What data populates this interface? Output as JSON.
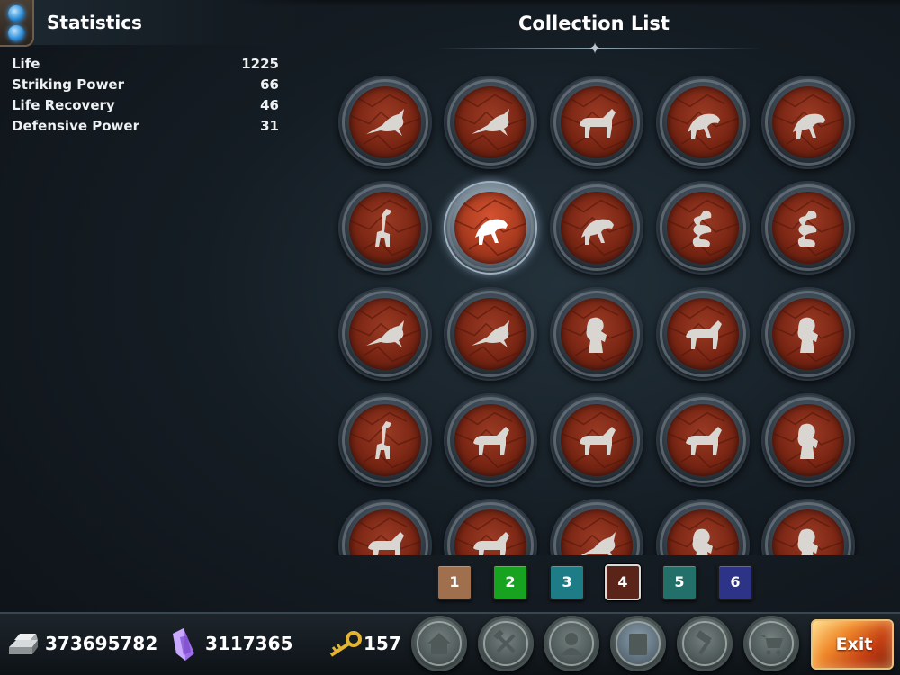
{
  "stats": {
    "title": "Statistics",
    "rows": [
      {
        "label": "Life",
        "value": "1225"
      },
      {
        "label": "Striking Power",
        "value": "66"
      },
      {
        "label": "Life Recovery",
        "value": "46"
      },
      {
        "label": "Defensive Power",
        "value": "31"
      }
    ]
  },
  "collection": {
    "title": "Collection List",
    "selected_index": 6,
    "items": [
      {
        "icon": "swordfish-icon"
      },
      {
        "icon": "marlin-icon"
      },
      {
        "icon": "moose-icon"
      },
      {
        "icon": "iguana-icon"
      },
      {
        "icon": "monkey-icon"
      },
      {
        "icon": "deer-icon"
      },
      {
        "icon": "leopard-icon"
      },
      {
        "icon": "cat-icon"
      },
      {
        "icon": "snake-icon"
      },
      {
        "icon": "cobra-icon"
      },
      {
        "icon": "hammerhead-shark-icon"
      },
      {
        "icon": "dolphin-icon"
      },
      {
        "icon": "lion-icon"
      },
      {
        "icon": "bull-icon"
      },
      {
        "icon": "bear-icon"
      },
      {
        "icon": "giraffe-icon"
      },
      {
        "icon": "rhino-icon"
      },
      {
        "icon": "rhinoceros-icon"
      },
      {
        "icon": "elephant-icon"
      },
      {
        "icon": "gorilla-icon"
      },
      {
        "icon": "hippo-icon"
      },
      {
        "icon": "mammoth-icon"
      },
      {
        "icon": "shark-icon"
      },
      {
        "icon": "seahorse-icon"
      },
      {
        "icon": "horse-icon"
      }
    ]
  },
  "pages": [
    {
      "label": "1",
      "color": "#a0704e"
    },
    {
      "label": "2",
      "color": "#17a320"
    },
    {
      "label": "3",
      "color": "#1d7c86"
    },
    {
      "label": "4",
      "color": "#5a2418"
    },
    {
      "label": "5",
      "color": "#236f6a"
    },
    {
      "label": "6",
      "color": "#2d3487"
    }
  ],
  "active_page": "4",
  "resources": {
    "silver": "373695782",
    "crystal": "3117365",
    "keys": "157"
  },
  "menu": [
    {
      "icon": "home-icon"
    },
    {
      "icon": "tools-icon"
    },
    {
      "icon": "character-icon"
    },
    {
      "icon": "collection-book-icon"
    },
    {
      "icon": "hammer-icon"
    },
    {
      "icon": "shop-cart-icon"
    }
  ],
  "exit_label": "Exit"
}
